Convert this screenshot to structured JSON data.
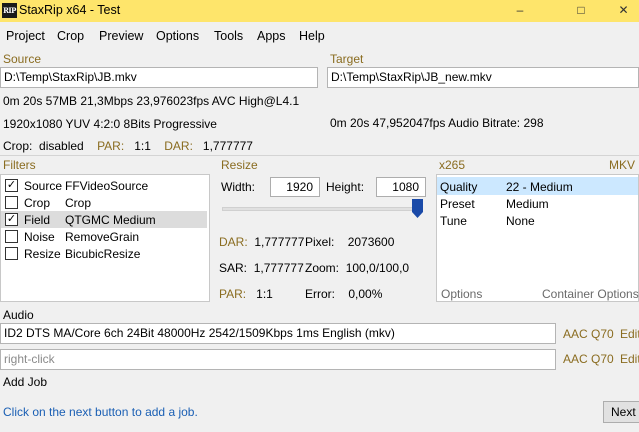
{
  "app": {
    "icon_text": "RIP",
    "title": "StaxRip x64 - Test",
    "title_color": "#fee56b"
  },
  "window_buttons": {
    "minimize": "–",
    "maximize": "□",
    "close": "✕"
  },
  "menu": [
    "Project",
    "Crop",
    "Preview",
    "Options",
    "Tools",
    "Apps",
    "Help"
  ],
  "source": {
    "header": "Source",
    "path": "D:\\Temp\\StaxRip\\JB.mkv",
    "info_line1": "0m 20s  57MB  21,3Mbps  23,976023fps  AVC  High@L4.1",
    "info_line2": "1920x1080  YUV  4:2:0  8Bits  Progressive",
    "crop_label": "Crop:",
    "crop_value": "disabled",
    "par_label": "PAR:",
    "par_value": "1:1",
    "dar_label": "DAR:",
    "dar_value": "1,777777"
  },
  "target": {
    "header": "Target",
    "path": "D:\\Temp\\StaxRip\\JB_new.mkv",
    "info_line": "0m 20s   47,952047fps   Audio Bitrate: 298"
  },
  "filters": {
    "header": "Filters",
    "items": [
      {
        "checked": true,
        "category": "Source",
        "name": "FFVideoSource",
        "selected": false
      },
      {
        "checked": false,
        "category": "Crop",
        "name": "Crop",
        "selected": false
      },
      {
        "checked": true,
        "category": "Field",
        "name": "QTGMC Medium",
        "selected": true
      },
      {
        "checked": false,
        "category": "Noise",
        "name": "RemoveGrain",
        "selected": false
      },
      {
        "checked": false,
        "category": "Resize",
        "name": "BicubicResize",
        "selected": false
      }
    ]
  },
  "resize": {
    "header": "Resize",
    "width_label": "Width:",
    "width_value": "1920",
    "height_label": "Height:",
    "height_value": "1080",
    "slider_position": 1.0,
    "dar_label": "DAR:",
    "dar_value": "1,777777",
    "pixel_label": "Pixel:",
    "pixel_value": "2073600",
    "sar_label": "SAR:",
    "sar_value": "1,777777",
    "zoom_label": "Zoom:",
    "zoom_value": "100,0/100,0",
    "par_label": "PAR:",
    "par_value": "1:1",
    "error_label": "Error:",
    "error_value": "0,00%"
  },
  "encoder": {
    "header": "x265",
    "container": "MKV",
    "rows": [
      {
        "label": "Quality",
        "value": "22 - Medium",
        "selected": true
      },
      {
        "label": "Preset",
        "value": "Medium",
        "selected": false
      },
      {
        "label": "Tune",
        "value": "None",
        "selected": false
      }
    ],
    "options_link": "Options",
    "container_options_link": "Container Options",
    "selection_color": "#cce8ff"
  },
  "audio": {
    "header": "Audio",
    "track1": "ID2 DTS MA/Core 6ch 24Bit 48000Hz 2542/1509Kbps 1ms English (mkv)",
    "track1_profile": "AAC Q70",
    "track1_edit": "Edit",
    "track2_placeholder": "right-click",
    "track2_profile": "AAC Q70",
    "track2_edit": "Edit"
  },
  "job": {
    "header": "Add Job",
    "hint": "Click on the next button to add a job.",
    "hint_color": "#1a5fb4",
    "next_button": "Next"
  }
}
